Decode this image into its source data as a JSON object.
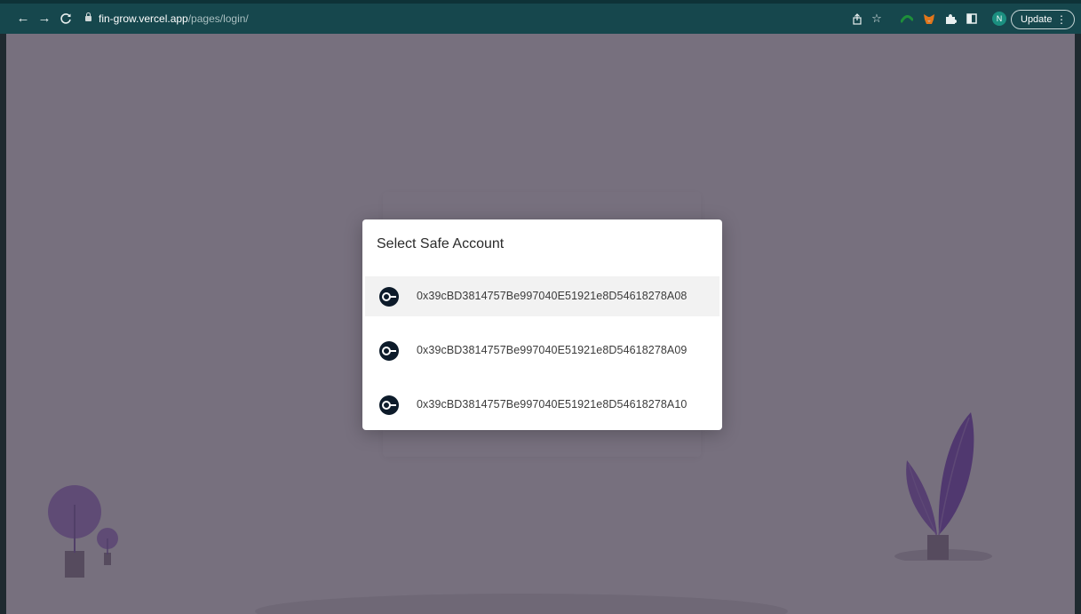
{
  "browser": {
    "url_host": "fin-grow.vercel.app",
    "url_path": "/pages/login/",
    "profile_initial": "N",
    "update_label": "Update",
    "toolbar_icons": [
      "back-icon",
      "forward-icon",
      "reload-icon",
      "lock-icon",
      "share-icon",
      "star-icon",
      "extension-icon",
      "metamask-icon",
      "puzzle-icon",
      "sidepanel-icon",
      "menu-icon"
    ]
  },
  "modal": {
    "title": "Select Safe Account",
    "accounts": [
      {
        "address": "0x39cBD3814757Be997040E51921e8D54618278A08",
        "selected": true
      },
      {
        "address": "0x39cBD3814757Be997040E51921e8D54618278A09",
        "selected": false
      },
      {
        "address": "0x39cBD3814757Be997040E51921e8D54618278A10",
        "selected": false
      }
    ],
    "account_icon": "safe-coin-icon"
  },
  "colors": {
    "chrome_bg": "#16474d",
    "backdrop": "#6e6777",
    "plant_purple": "#7a53ad",
    "coin_dark": "#0d1b2a"
  }
}
